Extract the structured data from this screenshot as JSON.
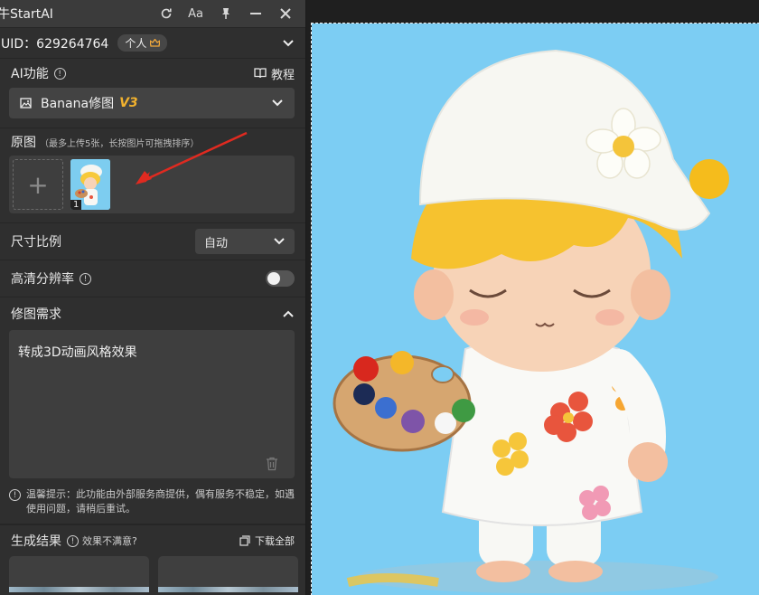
{
  "titlebar": {
    "app_name": "牛StartAI",
    "buttons": [
      {
        "icon": "refresh-icon"
      },
      {
        "icon": "font-size-icon",
        "label": "Aa"
      },
      {
        "icon": "pin-icon"
      },
      {
        "icon": "minimize-icon"
      },
      {
        "icon": "close-icon"
      }
    ]
  },
  "account": {
    "uid_text": "UID：629264764",
    "plan_badge": "个人"
  },
  "ai_function": {
    "label": "AI功能",
    "tutorial_label": "教程",
    "selected_tool": "Banana修图",
    "version": "V3"
  },
  "source_images": {
    "label": "原图",
    "hint": "（最多上传5张，长按图片可拖拽排序）",
    "thumbnails": [
      {
        "index": "1"
      }
    ]
  },
  "aspect_ratio": {
    "label": "尺寸比例",
    "value": "自动"
  },
  "hd_resolution": {
    "label": "高清分辨率",
    "enabled": false
  },
  "edit_request": {
    "label": "修图需求",
    "text": "转成3D动画风格效果"
  },
  "notice": {
    "text": "温馨提示：此功能由外部服务商提供，偶有服务不稳定，如遇使用问题，请稍后重试。"
  },
  "results": {
    "label": "生成结果",
    "feedback_link": "效果不满意?",
    "download_all": "下载全部"
  },
  "colors": {
    "panel_bg": "#2f2f2f",
    "accent_version": "#f2b22e",
    "arrow": "#e02a20",
    "canvas_art_bg": "#7ccdf3"
  }
}
